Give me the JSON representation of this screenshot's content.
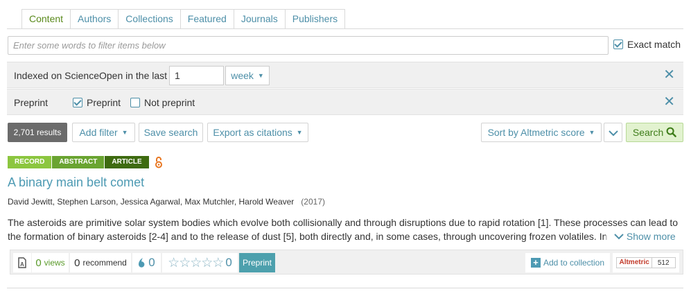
{
  "tabs": [
    {
      "label": "Content",
      "active": true
    },
    {
      "label": "Authors",
      "active": false
    },
    {
      "label": "Collections",
      "active": false
    },
    {
      "label": "Featured",
      "active": false
    },
    {
      "label": "Journals",
      "active": false
    },
    {
      "label": "Publishers",
      "active": false
    }
  ],
  "filter": {
    "placeholder": "Enter some words to filter items below",
    "value": "",
    "exact_match_label": "Exact match",
    "exact_match_checked": true
  },
  "indexed_filter": {
    "label": "Indexed on ScienceOpen in the last",
    "value": "1",
    "period": "week"
  },
  "preprint_filter": {
    "label": "Preprint",
    "options": [
      {
        "label": "Preprint",
        "checked": true
      },
      {
        "label": "Not preprint",
        "checked": false
      }
    ]
  },
  "toolbar": {
    "results_count": "2,701 results",
    "add_filter": "Add filter",
    "save_search": "Save search",
    "export": "Export as citations",
    "sort": "Sort by Altmetric score",
    "search": "Search"
  },
  "record": {
    "badges": [
      {
        "label": "RECORD",
        "color": "#8cc63f"
      },
      {
        "label": "ABSTRACT",
        "color": "#6aa431"
      },
      {
        "label": "ARTICLE",
        "color": "#3e6b10"
      }
    ],
    "open_access_icon": "open-lock-icon",
    "title": "A binary main belt comet",
    "authors": "David Jewitt, Stephen Larson, Jessica Agarwal, Max Mutchler, Harold Weaver",
    "year": "(2017)",
    "abstract": "The asteroids are primitive solar system bodies which evolve both collisionally and through disruptions due to rapid rotation [1]. These processes can lead to the formation of binary asteroids [2-4] and to the release of dust [5], both directly and, in some cases, through uncovering frozen volatiles. In",
    "show_more": "Show more",
    "views_count": "0",
    "views_label": "views",
    "recommend_count": "0",
    "recommend_label": "recommend",
    "comments_count": "0",
    "rating_count": "0",
    "preprint_tag": "Preprint",
    "add_collection": "Add to collection",
    "altmetric_label": "Altmetric",
    "altmetric_score": "512"
  },
  "colors": {
    "link": "#4d8fa8",
    "active_tab": "#5a8a1c",
    "search_bg": "#e2f2cf",
    "oa_orange": "#e87722"
  }
}
